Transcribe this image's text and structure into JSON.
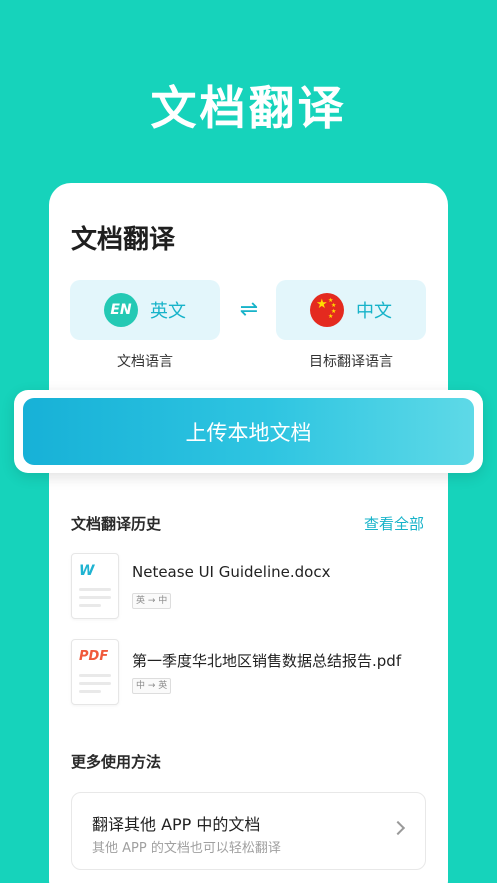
{
  "hero": {
    "title": "文档翻译"
  },
  "card": {
    "title": "文档翻译",
    "source_lang": {
      "badge": "EN",
      "name": "英文",
      "caption": "文档语言"
    },
    "target_lang": {
      "name": "中文",
      "caption": "目标翻译语言"
    },
    "swap_symbol": "⇌"
  },
  "upload": {
    "label": "上传本地文档"
  },
  "history": {
    "title": "文档翻译历史",
    "view_all": "查看全部",
    "items": [
      {
        "type_tag": "W",
        "type_color": "#1fb3d1",
        "name": "Netease UI Guideline.docx",
        "pair": "英 → 中"
      },
      {
        "type_tag": "PDF",
        "type_color": "#f05a3c",
        "name": "第一季度华北地区销售数据总结报告.pdf",
        "pair": "中 → 英"
      }
    ]
  },
  "more": {
    "title": "更多使用方法",
    "item": {
      "title": "翻译其他 APP 中的文档",
      "subtitle": "其他 APP 的文档也可以轻松翻译"
    }
  }
}
